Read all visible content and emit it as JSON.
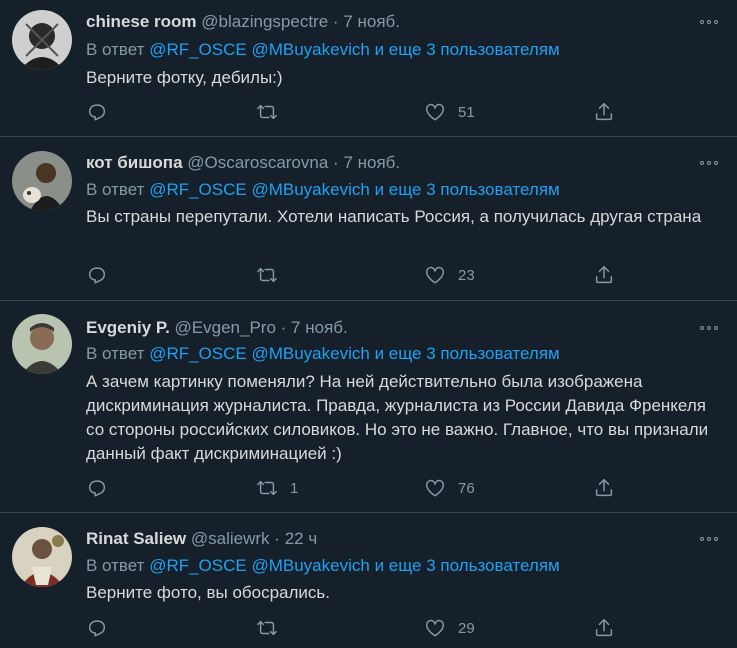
{
  "tweets": [
    {
      "name": "chinese room",
      "handle": "@blazingspectre",
      "sep": "·",
      "time": "7 нояб.",
      "reply_prefix": "В ответ",
      "reply_to": "@RF_OSCE @MBuyakevich",
      "reply_more": "и еще 3 пользователям",
      "text": "Верните фотку, дебилы:)",
      "replies": "",
      "retweets": "",
      "likes": "51"
    },
    {
      "name": "кот бишопа",
      "handle": "@Oscaroscarovna",
      "sep": "·",
      "time": "7 нояб.",
      "reply_prefix": "В ответ",
      "reply_to": "@RF_OSCE @MBuyakevich",
      "reply_more": "и еще 3 пользователям",
      "text": "Вы страны перепутали. Хотели написать Россия, а получилась другая страна",
      "replies": "",
      "retweets": "",
      "likes": "23"
    },
    {
      "name": "Evgeniy P.",
      "handle": "@Evgen_Pro",
      "sep": "·",
      "time": "7 нояб.",
      "reply_prefix": "В ответ",
      "reply_to": "@RF_OSCE @MBuyakevich",
      "reply_more": "и еще 3 пользователям",
      "text": "А зачем картинку поменяли? На ней действительно была изображена дискриминация журналиста. Правда, журналиста из России Давида Френкеля  со стороны российских силовиков. Но это не важно. Главное, что вы признали данный факт дискриминацией :)",
      "replies": "",
      "retweets": "1",
      "likes": "76"
    },
    {
      "name": "Rinat Saliew",
      "handle": "@saliewrk",
      "sep": "·",
      "time": "22 ч",
      "reply_prefix": "В ответ",
      "reply_to": "@RF_OSCE @MBuyakevich",
      "reply_more": "и еще 3 пользователям",
      "text": "Верните фото, вы обосрались.",
      "replies": "",
      "retweets": "",
      "likes": "29"
    }
  ],
  "icons": {
    "reply": "reply-icon",
    "retweet": "retweet-icon",
    "like": "heart-icon",
    "share": "share-icon",
    "more": "more-options-icon"
  },
  "colors": {
    "background": "#15202b",
    "text": "#d9d9d9",
    "secondary": "#8899a6",
    "link": "#1da1f2",
    "divider": "#38444d"
  }
}
